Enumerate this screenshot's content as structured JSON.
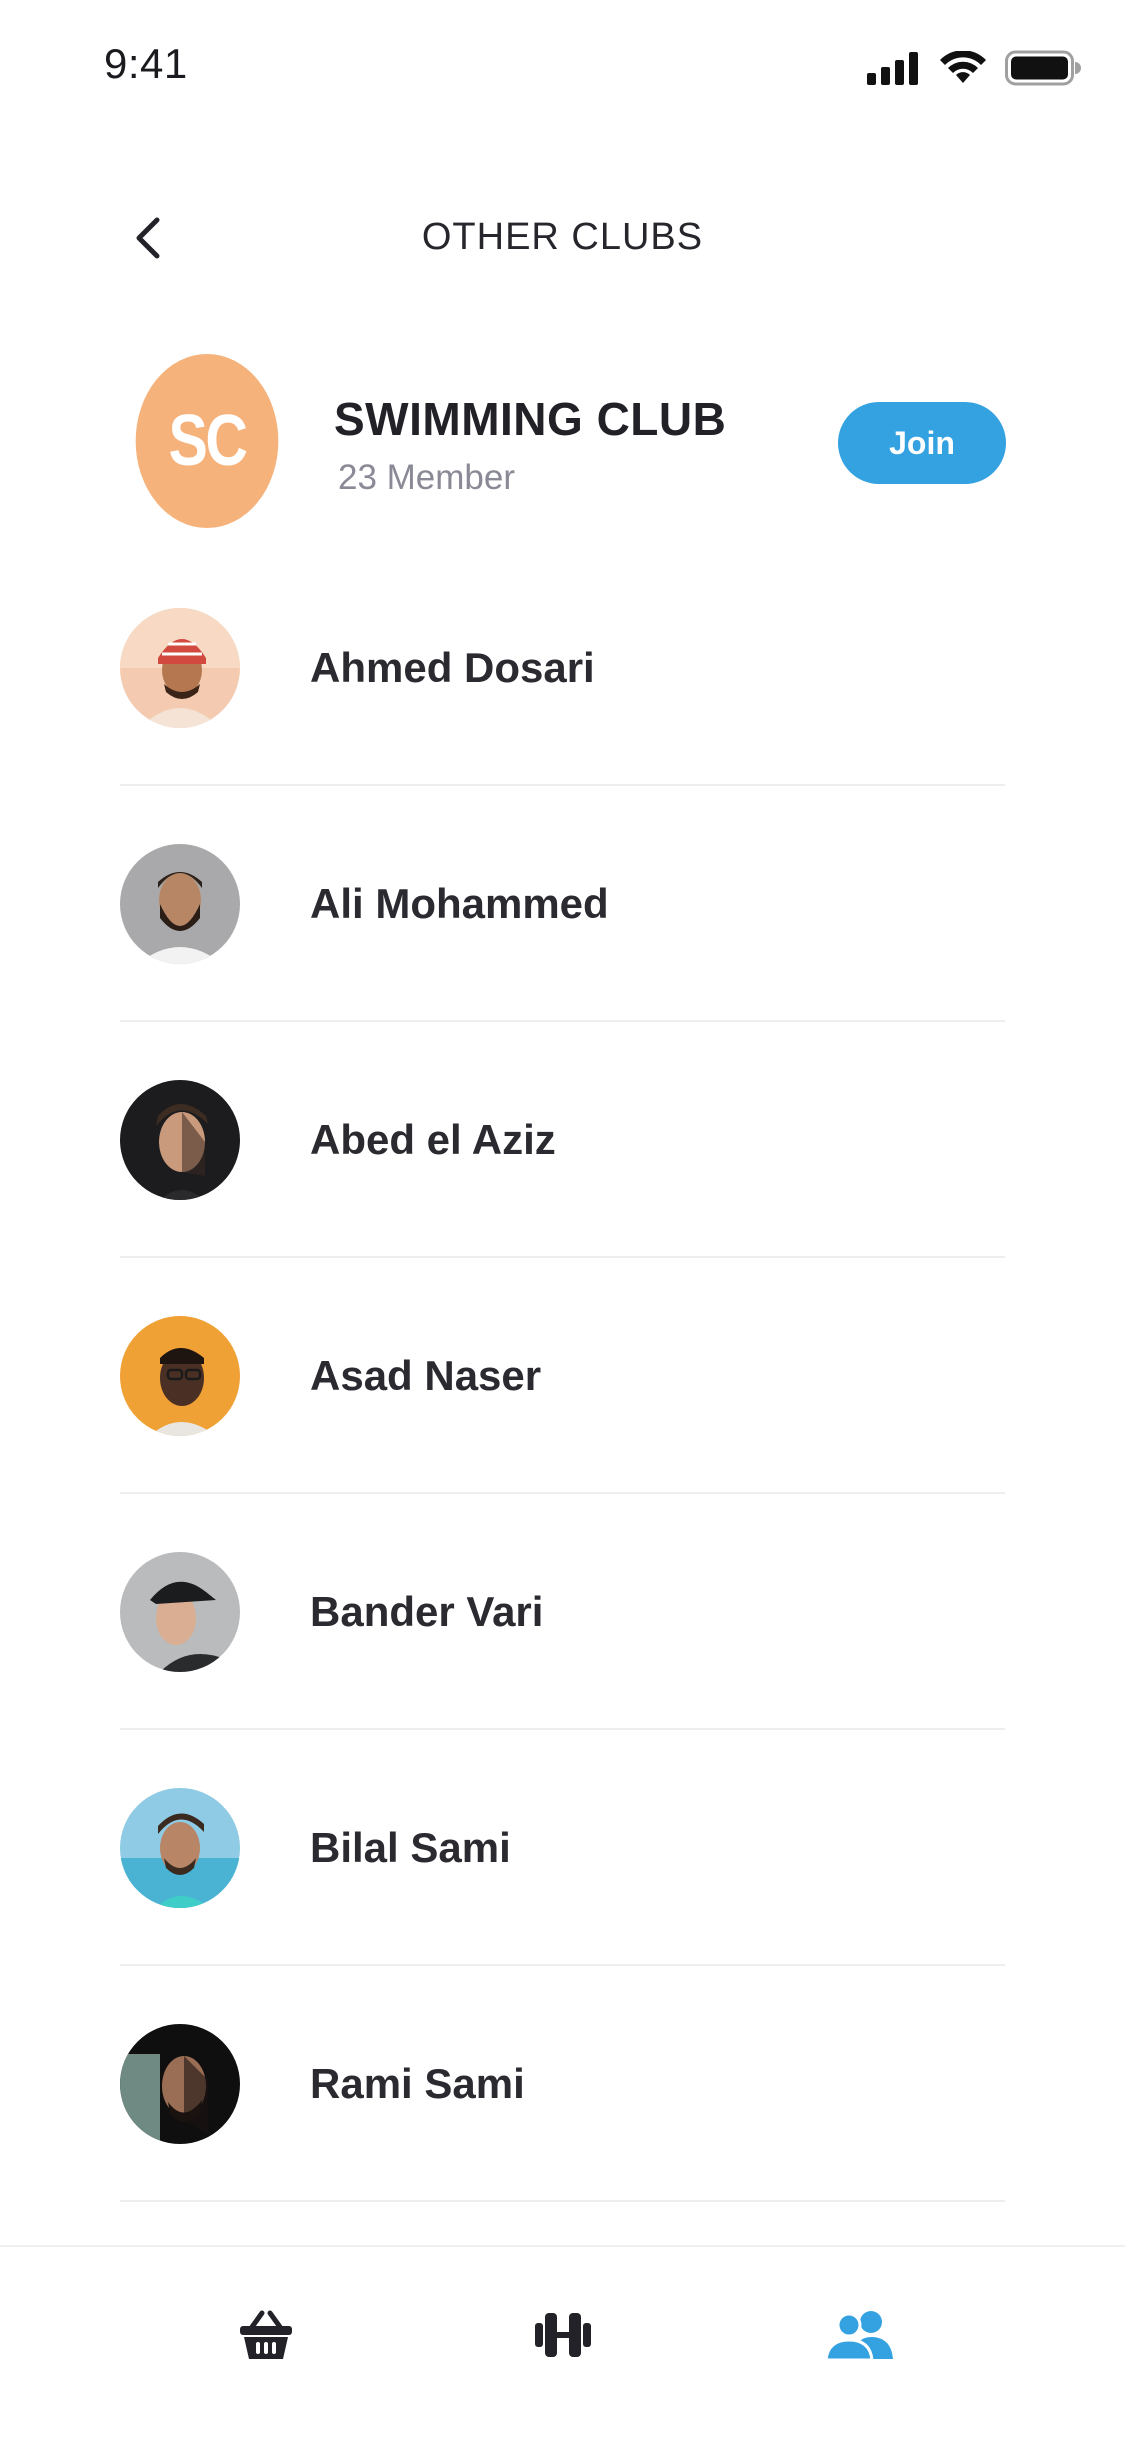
{
  "status_bar": {
    "time": "9:41",
    "icons": [
      "cellular-signal-icon",
      "wifi-icon",
      "battery-icon"
    ]
  },
  "header": {
    "title": "OTHER CLUBS",
    "back_icon": "chevron-left-icon"
  },
  "club": {
    "initials": "SC",
    "name": "SWIMMING CLUB",
    "members": "23 Member",
    "join_label": "Join",
    "avatar_color": "#f6b27b",
    "accent_color": "#34a2e1"
  },
  "members": [
    {
      "name": "Ahmed Dosari"
    },
    {
      "name": "Ali Mohammed"
    },
    {
      "name": "Abed el Aziz"
    },
    {
      "name": "Asad Naser"
    },
    {
      "name": "Bander Vari"
    },
    {
      "name": "Bilal Sami"
    },
    {
      "name": "Rami Sami"
    }
  ],
  "tab_bar": {
    "tabs": [
      {
        "icon": "shopping-basket-icon",
        "active": false
      },
      {
        "icon": "dumbbell-icon",
        "active": false
      },
      {
        "icon": "users-icon",
        "active": true
      }
    ],
    "active_color": "#34a2e1",
    "inactive_color": "#222228"
  }
}
